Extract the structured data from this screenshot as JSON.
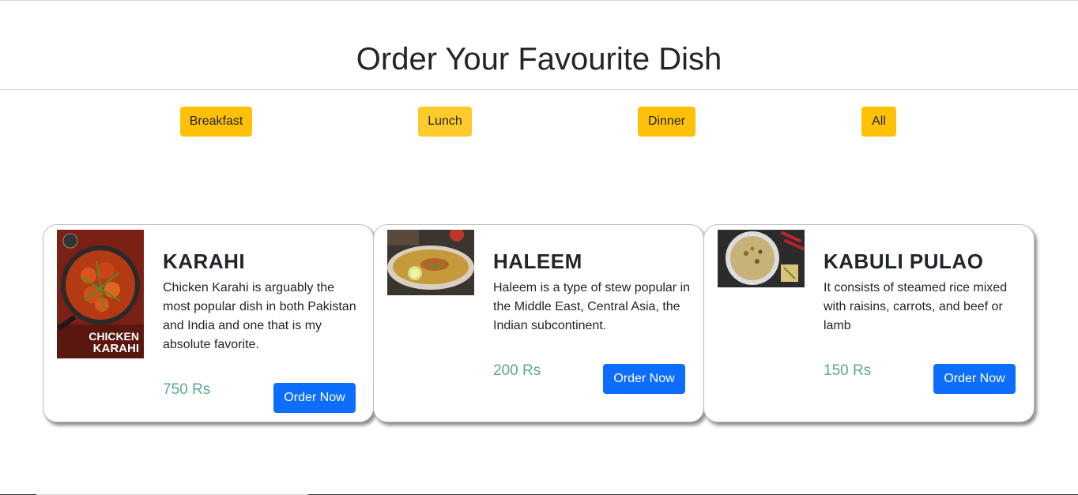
{
  "header": {
    "title": "Order Your Favourite Dish"
  },
  "filters": [
    {
      "label": "Breakfast"
    },
    {
      "label": "Lunch"
    },
    {
      "label": "Dinner"
    },
    {
      "label": "All"
    }
  ],
  "dishes": [
    {
      "name": "KARAHI",
      "description": "Chicken Karahi is arguably the most popular dish in both Pakistan and India and one that is my absolute favorite.",
      "price": "750 Rs",
      "order_label": "Order Now",
      "image_caption": "CHICKEN KARAHI"
    },
    {
      "name": "HALEEM",
      "description": "Haleem is a type of stew popular in the Middle East, Central Asia, the Indian subcontinent.",
      "price": "200 Rs",
      "order_label": "Order Now"
    },
    {
      "name": "KABULI PULAO",
      "description": "It consists of steamed rice mixed with raisins, carrots, and beef or lamb",
      "price": "150 Rs",
      "order_label": "Order Now"
    }
  ],
  "colors": {
    "filter_button": "#ffc107",
    "order_button": "#0d6efd",
    "price_text": "#5aa89a"
  }
}
